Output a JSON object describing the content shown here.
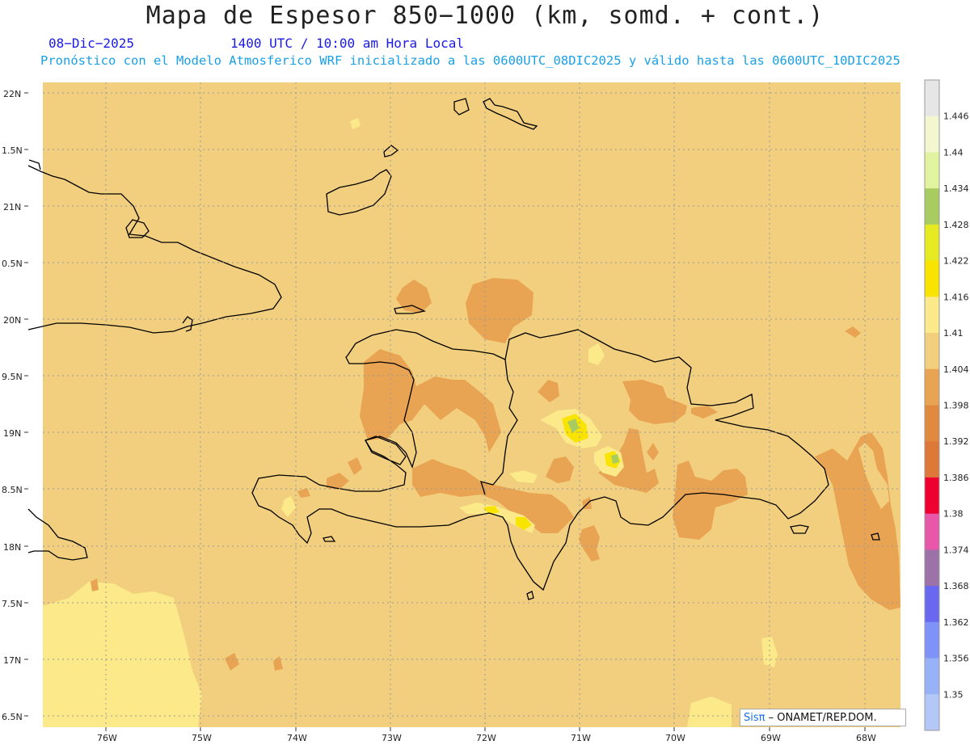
{
  "header": {
    "title": "Mapa de Espesor 850−1000 (km, somd. + cont.)",
    "date": "08−Dic−2025",
    "time": "1400 UTC / 10:00 am Hora Local",
    "forecast_note": "Pronóstico con el Modelo Atmosferico WRF inicializado a las 0600UTC_08DIC2025 y válido hasta las  0600UTC_10DIC2025"
  },
  "map": {
    "lat_labels": [
      "22N",
      "1.5N",
      "21N",
      "0.5N",
      "20N",
      "9.5N",
      "19N",
      "8.5N",
      "18N",
      "7.5N",
      "17N",
      "6.5N"
    ],
    "lon_labels": [
      "76W",
      "75W",
      "74W",
      "73W",
      "72W",
      "71W",
      "70W",
      "69W",
      "68W"
    ],
    "base_color": "#f2cf7e",
    "coastline_color": "#000000"
  },
  "colorbar": {
    "labels": [
      "1.446",
      "1.44",
      "1.434",
      "1.428",
      "1.422",
      "1.416",
      "1.41",
      "1.404",
      "1.398",
      "1.392",
      "1.386",
      "1.38",
      "1.374",
      "1.368",
      "1.362",
      "1.356",
      "1.35"
    ],
    "colors": [
      "#e6e6e6",
      "#f2f7d0",
      "#e2f3a0",
      "#a8cc60",
      "#e6ea20",
      "#f8e400",
      "#fbe98a",
      "#f2cf7e",
      "#e8a452",
      "#e08a40",
      "#de7838",
      "#ee0030",
      "#e857a8",
      "#9d72a8",
      "#6868f0",
      "#7e92f8",
      "#98b2f8",
      "#b4c8f8"
    ]
  },
  "credit": {
    "brand": "Sisπ",
    "text": "– ONAMET/REP.DOM."
  }
}
